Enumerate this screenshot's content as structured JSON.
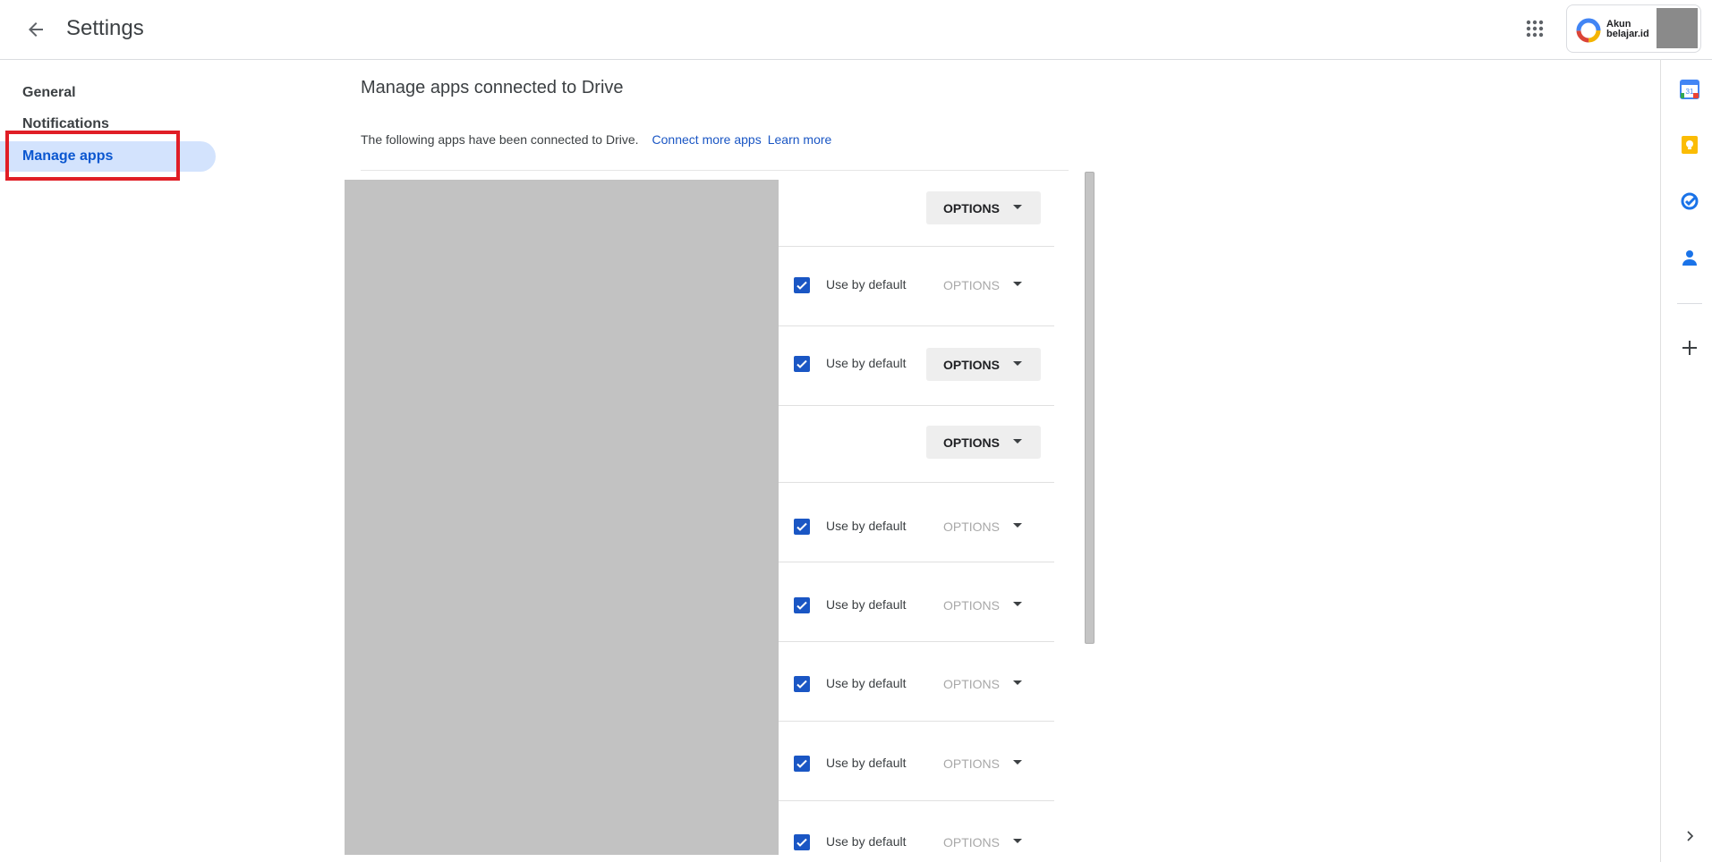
{
  "header": {
    "title": "Settings",
    "account": {
      "line1": "Akun",
      "line2": "belajar.id"
    }
  },
  "nav": {
    "items": [
      {
        "label": "General",
        "active": false
      },
      {
        "label": "Notifications",
        "active": false
      },
      {
        "label": "Manage apps",
        "active": true
      }
    ]
  },
  "main": {
    "heading": "Manage apps connected to Drive",
    "description": "The following apps have been connected to Drive.",
    "connect_link": "Connect more apps",
    "learn_link": "Learn more"
  },
  "apps": [
    {
      "checkbox": false,
      "checkbox_label": "",
      "options_label": "OPTIONS",
      "options_enabled": true
    },
    {
      "checkbox": true,
      "checkbox_label": "Use by default",
      "options_label": "OPTIONS",
      "options_enabled": false
    },
    {
      "checkbox": true,
      "checkbox_label": "Use by default",
      "options_label": "OPTIONS",
      "options_enabled": true
    },
    {
      "checkbox": false,
      "checkbox_label": "",
      "options_label": "OPTIONS",
      "options_enabled": true
    },
    {
      "checkbox": true,
      "checkbox_label": "Use by default",
      "options_label": "OPTIONS",
      "options_enabled": false
    },
    {
      "checkbox": true,
      "checkbox_label": "Use by default",
      "options_label": "OPTIONS",
      "options_enabled": false
    },
    {
      "checkbox": true,
      "checkbox_label": "Use by default",
      "options_label": "OPTIONS",
      "options_enabled": false
    },
    {
      "checkbox": true,
      "checkbox_label": "Use by default",
      "options_label": "OPTIONS",
      "options_enabled": false
    },
    {
      "checkbox": true,
      "checkbox_label": "Use by default",
      "options_label": "OPTIONS",
      "options_enabled": false
    }
  ],
  "side_panel": {
    "calendar_day": "31",
    "icons": [
      "calendar-icon",
      "keep-icon",
      "tasks-icon",
      "contacts-icon",
      "add-icon",
      "expand-icon"
    ]
  },
  "colors": {
    "accent": "#0b57d0",
    "link": "#1a56c4",
    "nav_active_bg": "#d3e3fd",
    "highlight": "#e01e26",
    "placeholder": "#c2c2c2"
  }
}
